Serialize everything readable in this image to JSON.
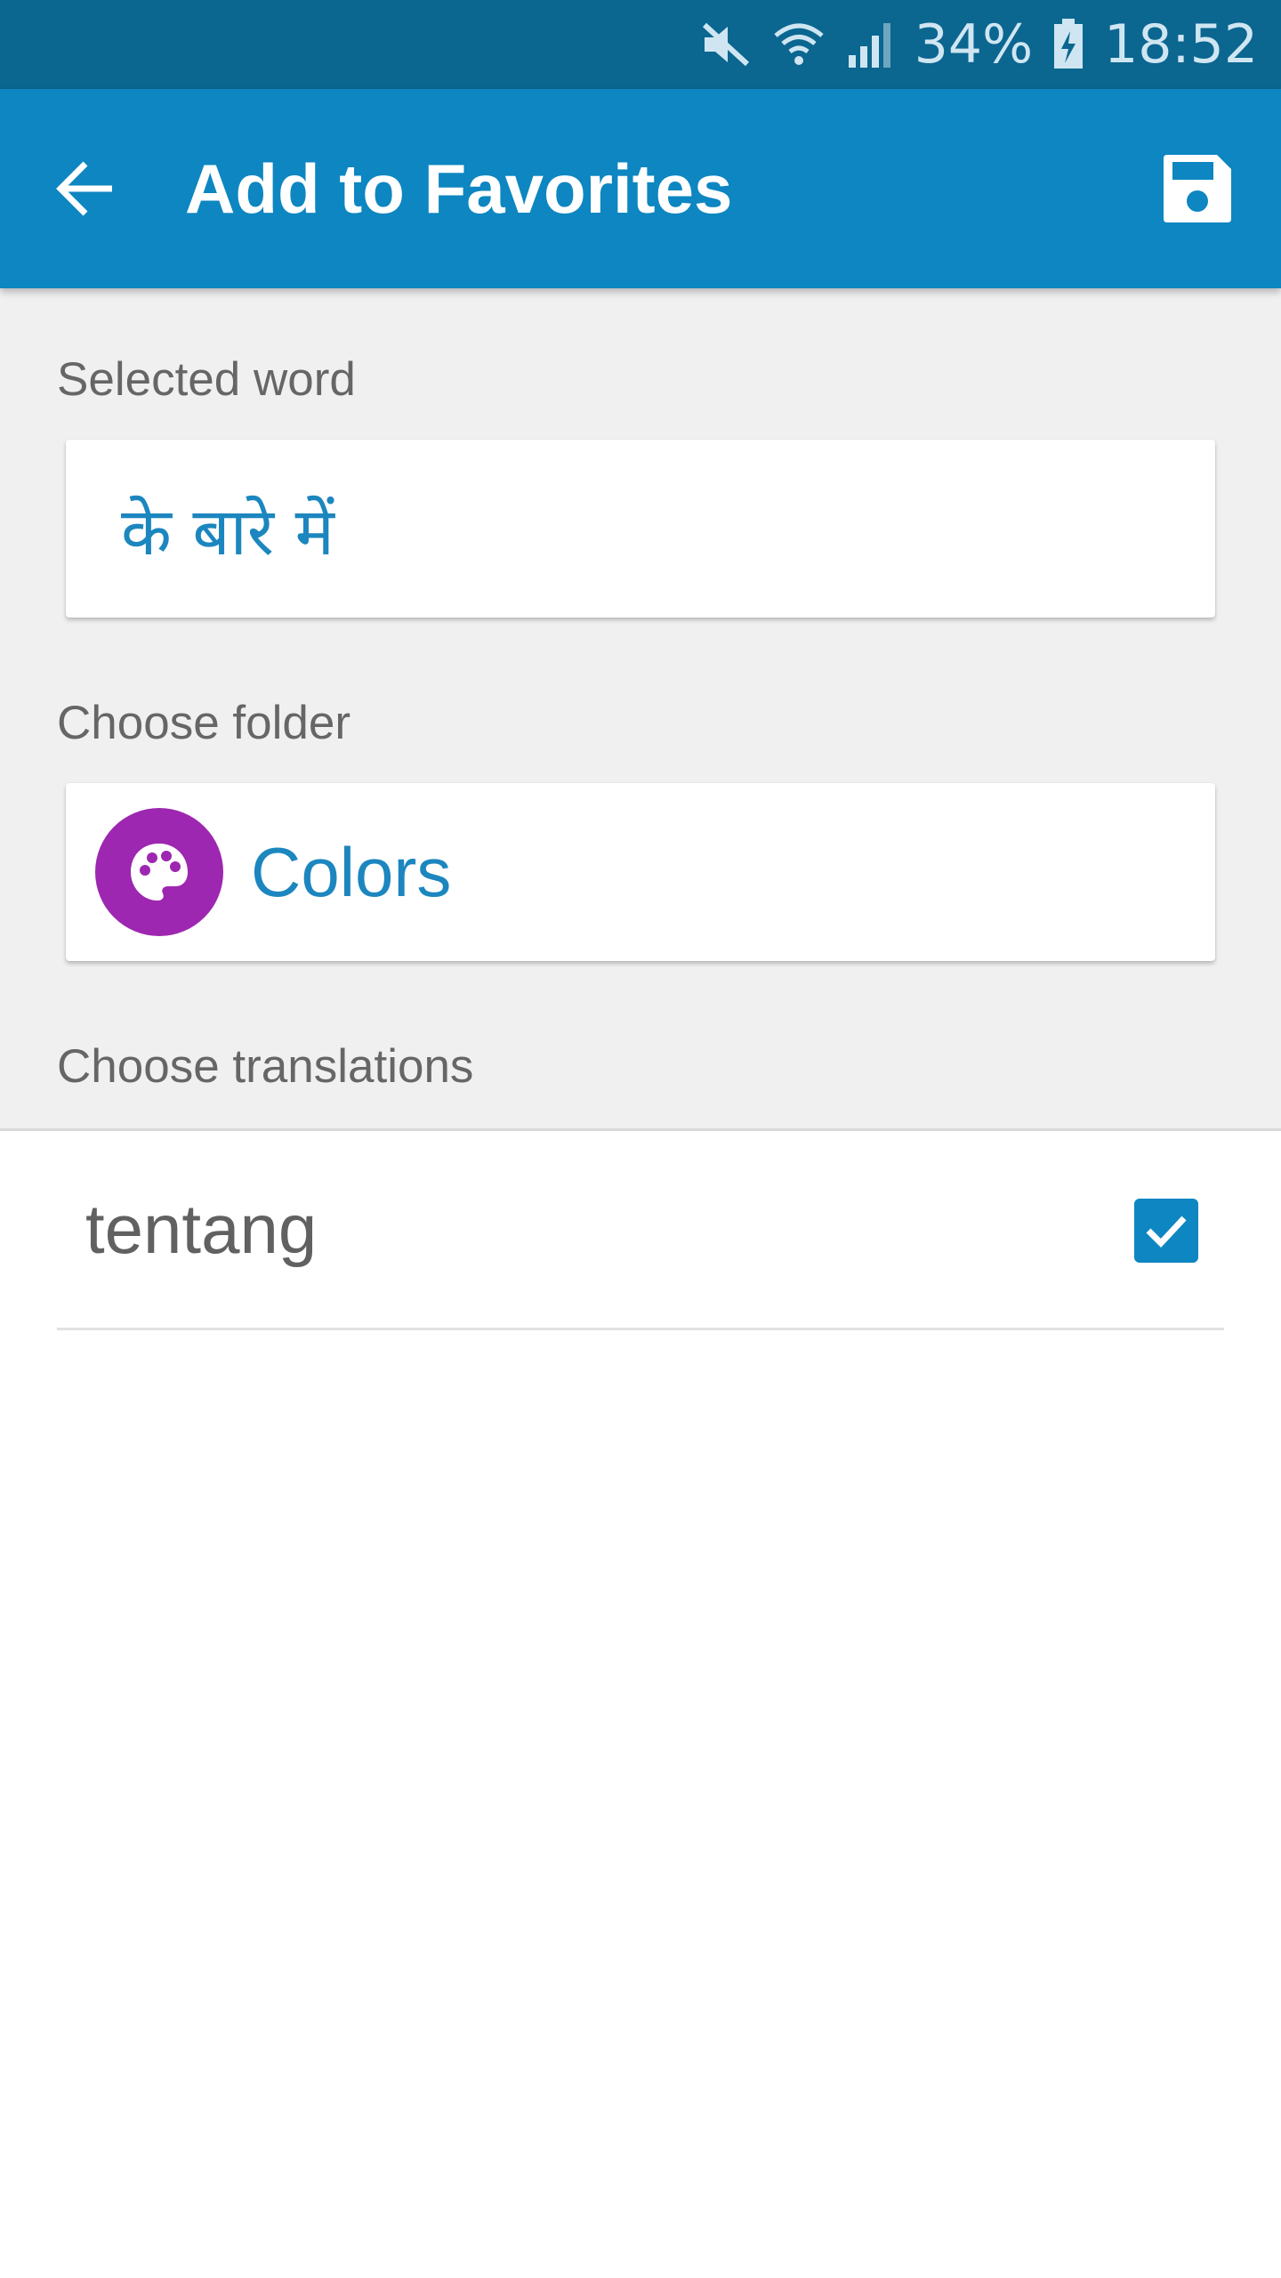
{
  "status_bar": {
    "battery_percent": "34%",
    "time": "18:52",
    "icons": [
      "mute-icon",
      "wifi-icon",
      "signal-icon",
      "battery-charging-icon"
    ]
  },
  "app_bar": {
    "title": "Add to Favorites",
    "back_icon": "arrow-back-icon",
    "save_icon": "save-floppy-icon",
    "color": "#0d86c1"
  },
  "selected_word": {
    "label": "Selected word",
    "value": "के बारे में"
  },
  "folder": {
    "label": "Choose folder",
    "name": "Colors",
    "icon": "palette-icon",
    "icon_color": "#9d27b0"
  },
  "translations": {
    "label": "Choose translations",
    "items": [
      {
        "text": "tentang",
        "checked": true
      }
    ]
  }
}
